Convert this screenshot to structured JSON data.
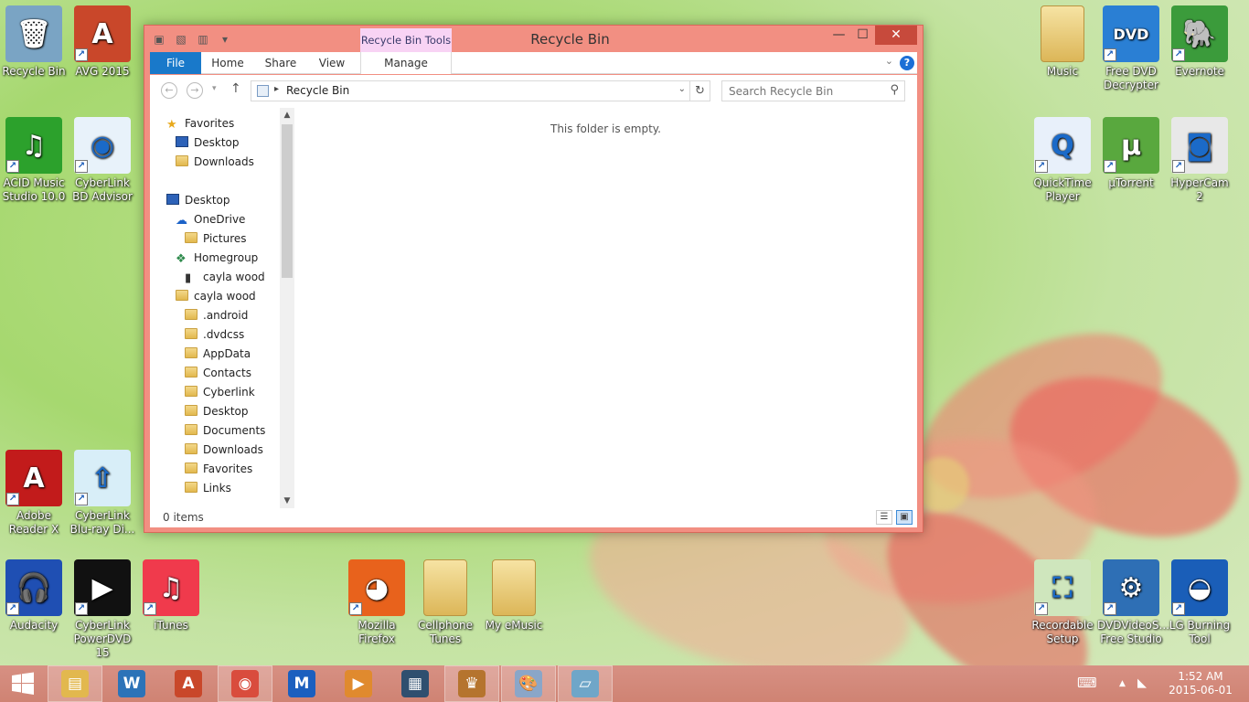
{
  "window": {
    "title": "Recycle Bin",
    "context_tab": "Recycle Bin Tools",
    "minimize": "—",
    "maximize": "☐",
    "close": "✕"
  },
  "ribbon": {
    "tabs": [
      "File",
      "Home",
      "Share",
      "View",
      "Manage"
    ],
    "help": "?"
  },
  "address": {
    "path": "Recycle Bin",
    "search_placeholder": "Search Recycle Bin"
  },
  "nav": {
    "items": [
      {
        "label": "Favorites",
        "icon": "star-icon"
      },
      {
        "label": "Desktop",
        "icon": "desktop-icon"
      },
      {
        "label": "Downloads",
        "icon": "folder-icon"
      },
      {
        "label": "Desktop",
        "icon": "desktop-icon"
      },
      {
        "label": "OneDrive",
        "icon": "cloud-icon"
      },
      {
        "label": "Pictures",
        "icon": "folder-icon"
      },
      {
        "label": "Homegroup",
        "icon": "homegroup-icon"
      },
      {
        "label": "cayla wood",
        "icon": "user-icon"
      },
      {
        "label": "cayla wood",
        "icon": "folder-icon"
      },
      {
        "label": ".android",
        "icon": "folder-icon"
      },
      {
        "label": ".dvdcss",
        "icon": "folder-icon"
      },
      {
        "label": "AppData",
        "icon": "folder-icon"
      },
      {
        "label": "Contacts",
        "icon": "folder-icon"
      },
      {
        "label": "Cyberlink",
        "icon": "folder-icon"
      },
      {
        "label": "Desktop",
        "icon": "folder-icon"
      },
      {
        "label": "Documents",
        "icon": "folder-icon"
      },
      {
        "label": "Downloads",
        "icon": "folder-icon"
      },
      {
        "label": "Favorites",
        "icon": "folder-icon"
      },
      {
        "label": "Links",
        "icon": "folder-icon"
      }
    ]
  },
  "content": {
    "empty_message": "This folder is empty."
  },
  "status": {
    "item_count": "0 items"
  },
  "desktop_icons": [
    {
      "label": "Recycle Bin",
      "icon": "recycle-bin-icon",
      "color": "#7aa4c4",
      "glyph": "🗑"
    },
    {
      "label": "AVG 2015",
      "icon": "avg-icon",
      "color": "#c9472a",
      "glyph": "A"
    },
    {
      "label": "ACID Music Studio 10.0",
      "icon": "acid-music-icon",
      "color": "#2ca12c",
      "glyph": "♫"
    },
    {
      "label": "CyberLink BD Advisor",
      "icon": "cyberlink-bd-icon",
      "color": "#e8f2fa",
      "glyph": "◉"
    },
    {
      "label": "Adobe Reader X",
      "icon": "adobe-reader-icon",
      "color": "#c21b1b",
      "glyph": "A"
    },
    {
      "label": "CyberLink Blu-ray Di...",
      "icon": "cyberlink-bluray-icon",
      "color": "#d8eef8",
      "glyph": "⇧"
    },
    {
      "label": "Audacity",
      "icon": "audacity-icon",
      "color": "#1f4fb3",
      "glyph": "🎧"
    },
    {
      "label": "CyberLink PowerDVD 15",
      "icon": "powerdvd-icon",
      "color": "#111111",
      "glyph": "▶"
    },
    {
      "label": "iTunes",
      "icon": "itunes-icon",
      "color": "#f03a4c",
      "glyph": "♫"
    },
    {
      "label": "Mozilla Firefox",
      "icon": "firefox-icon",
      "color": "#e8621c",
      "glyph": "◕"
    },
    {
      "label": "Cellphone Tunes",
      "icon": "folder-icon",
      "color": "#e5c774",
      "glyph": ""
    },
    {
      "label": "My eMusic",
      "icon": "folder-icon",
      "color": "#e5c774",
      "glyph": ""
    },
    {
      "label": "Music",
      "icon": "folder-icon",
      "color": "#e5c774",
      "glyph": ""
    },
    {
      "label": "Free DVD Decrypter",
      "icon": "dvd-decrypter-icon",
      "color": "#2a7fd4",
      "glyph": "DVD"
    },
    {
      "label": "Evernote",
      "icon": "evernote-icon",
      "color": "#3b9b3b",
      "glyph": "🐘"
    },
    {
      "label": "QuickTime Player",
      "icon": "quicktime-icon",
      "color": "#e8f0fa",
      "glyph": "Q"
    },
    {
      "label": "µTorrent",
      "icon": "utorrent-icon",
      "color": "#59a83e",
      "glyph": "µ"
    },
    {
      "label": "HyperCam 2",
      "icon": "hypercam-icon",
      "color": "#e8e8e8",
      "glyph": "◙"
    },
    {
      "label": "Recordable Setup",
      "icon": "recordable-icon",
      "color": "#cfe6bd",
      "glyph": "⛶"
    },
    {
      "label": "DVDVideoS... Free Studio",
      "icon": "dvdvideosoft-icon",
      "color": "#2e6fb5",
      "glyph": "⚙"
    },
    {
      "label": "LG Burning Tool",
      "icon": "lg-burning-icon",
      "color": "#1a5eb8",
      "glyph": "◒"
    }
  ],
  "taskbar": {
    "apps": [
      {
        "icon": "file-explorer-icon",
        "glyph": "▤",
        "color": "#e2b84e"
      },
      {
        "icon": "wordperfect-icon",
        "glyph": "W",
        "color": "#2c73b8"
      },
      {
        "icon": "avg-icon",
        "glyph": "A",
        "color": "#c9472a"
      },
      {
        "icon": "chrome-icon",
        "glyph": "◉",
        "color": "#d94c3d"
      },
      {
        "icon": "malwarebytes-icon",
        "glyph": "M",
        "color": "#1b5fbf"
      },
      {
        "icon": "media-player-icon",
        "glyph": "▶",
        "color": "#e08a2e"
      },
      {
        "icon": "video-editor-icon",
        "glyph": "▦",
        "color": "#2f4f6f"
      },
      {
        "icon": "app-icon",
        "glyph": "♛",
        "color": "#b5742e"
      },
      {
        "icon": "paint-icon",
        "glyph": "🎨",
        "color": "#8aa6c8"
      },
      {
        "icon": "notepad-icon",
        "glyph": "▱",
        "color": "#6fa6c8"
      }
    ],
    "time": "1:52 AM",
    "date": "2015-06-01"
  }
}
